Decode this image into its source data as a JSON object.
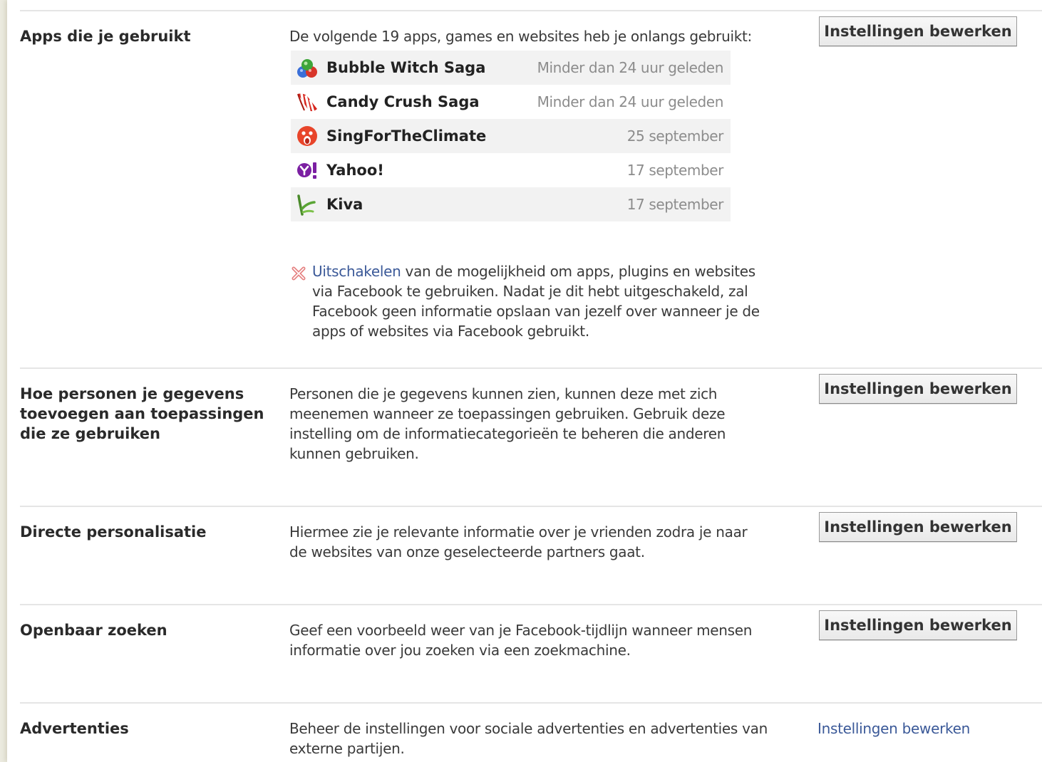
{
  "apps_section": {
    "title": "Apps die je gebruikt",
    "intro": "De volgende 19 apps, games en websites heb je onlangs gebruikt:",
    "edit_button": "Instellingen bewerken",
    "apps": [
      {
        "name": "Bubble Witch Saga",
        "time": "Minder dan 24 uur geleden",
        "icon": "bubble-witch-saga-icon"
      },
      {
        "name": "Candy Crush Saga",
        "time": "Minder dan 24 uur geleden",
        "icon": "candy-crush-saga-icon"
      },
      {
        "name": "SingForTheClimate",
        "time": "25 september",
        "icon": "singfortheclimate-icon"
      },
      {
        "name": "Yahoo!",
        "time": "17 september",
        "icon": "yahoo-icon"
      },
      {
        "name": "Kiva",
        "time": "17 september",
        "icon": "kiva-icon"
      }
    ],
    "disable_link": "Uitschakelen",
    "disable_text": " van de mogelijkheid om apps, plugins en websites via Facebook te gebruiken. Nadat je dit hebt uitgeschakeld, zal Facebook geen informatie opslaan van jezelf over wanneer je de apps of websites via Facebook gebruikt."
  },
  "sections": [
    {
      "title": "Hoe personen je gegevens toevoegen aan toepassingen die ze gebruiken",
      "description": "Personen die je gegevens kunnen zien, kunnen deze met zich meenemen wanneer ze toepassingen gebruiken. Gebruik deze instelling om de informatiecategorieën te beheren die anderen kunnen gebruiken.",
      "action": "Instellingen bewerken"
    },
    {
      "title": "Directe personalisatie",
      "description": "Hiermee zie je relevante informatie over je vrienden zodra je naar de websites van onze geselecteerde partners gaat.",
      "action": "Instellingen bewerken"
    },
    {
      "title": "Openbaar zoeken",
      "description": "Geef een voorbeeld weer van je Facebook-tijdlijn wanneer mensen informatie over jou zoeken via een zoekmachine.",
      "action": "Instellingen bewerken"
    },
    {
      "title": "Advertenties",
      "description": "Beheer de instellingen voor sociale advertenties en advertenties van externe partijen.",
      "action": "Instellingen bewerken"
    }
  ],
  "colors": {
    "link": "#3b5998",
    "row_shade": "#f2f2f2",
    "divider": "#e5e5e5",
    "page_edge": "#ecebe0"
  }
}
